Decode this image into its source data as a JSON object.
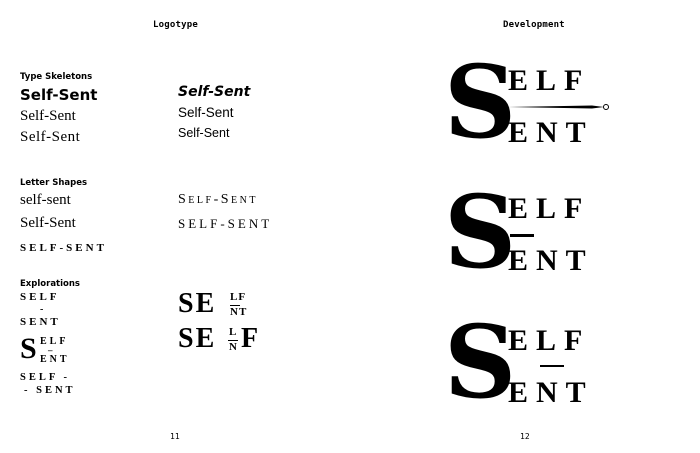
{
  "left_page": {
    "header": "Logotype",
    "folio": "11",
    "sections": {
      "type_skeletons": {
        "label": "Type Skeletons",
        "col1": [
          "Self-Sent",
          "Self-Sent",
          "Self-Sent"
        ],
        "col2": [
          "Self-Sent",
          "Self-Sent",
          "Self-Sent"
        ]
      },
      "letter_shapes": {
        "label": "Letter Shapes",
        "col1": [
          "self-sent",
          "Self-Sent",
          "SELF-SENT"
        ],
        "col2": [
          "Self-Sent",
          "SELF-SENT"
        ]
      },
      "explorations": {
        "label": "Explorations",
        "stack1": [
          "SELF",
          "-",
          "SENT"
        ],
        "stack2": {
          "big": "S",
          "top": "ELF",
          "dash": "–",
          "bottom": "ENT"
        },
        "stack3": [
          "SELF -",
          "- SENT"
        ],
        "lockup1": {
          "big": "SE",
          "top": "LF",
          "bottom": "NT"
        },
        "lockup2": {
          "big": "SE",
          "top": "L",
          "bottom": "N",
          "end": "F"
        }
      }
    }
  },
  "right_page": {
    "header": "Development",
    "folio": "12",
    "logos": [
      {
        "big": "S",
        "top": "ELF",
        "bottom": "ENT"
      },
      {
        "big": "S",
        "top": "ELF",
        "bottom": "ENT"
      },
      {
        "big": "S",
        "top": "ELF",
        "bottom": "ENT"
      }
    ]
  }
}
